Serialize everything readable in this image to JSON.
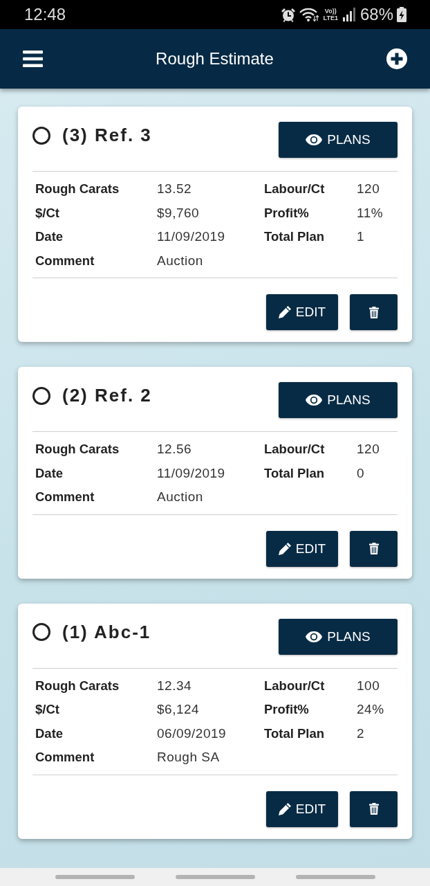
{
  "status_bar": {
    "time": "12:48",
    "network_lines": [
      "Vo))",
      "LTE1"
    ],
    "battery": "68%"
  },
  "app_bar": {
    "title": "Rough Estimate"
  },
  "cards": [
    {
      "title": "(3) Ref. 3",
      "selected": false,
      "plans_button": "PLANS",
      "rows": [
        {
          "label": "Rough Carats",
          "value": "13.52",
          "label_2": "Labour/Ct",
          "value_2": "120"
        },
        {
          "label": "$/Ct",
          "value": "$9,760",
          "label_2": "Profit%",
          "value_2": "11%"
        },
        {
          "label": "Date",
          "value": "11/09/2019",
          "label_2": "Total Plan",
          "value_2": "1"
        },
        {
          "label": "Comment",
          "value": "Auction"
        }
      ],
      "edit_button": "EDIT"
    },
    {
      "title": "(2) Ref. 2",
      "selected": false,
      "plans_button": "PLANS",
      "rows": [
        {
          "label": "Rough Carats",
          "value": "12.56",
          "label_2": "Labour/Ct",
          "value_2": "120"
        },
        {
          "label": "Date",
          "value": "11/09/2019",
          "label_2": "Total Plan",
          "value_2": "0"
        },
        {
          "label": "Comment",
          "value": "Auction"
        }
      ],
      "edit_button": "EDIT"
    },
    {
      "title": "(1) Abc-1",
      "selected": false,
      "plans_button": "PLANS",
      "rows": [
        {
          "label": "Rough Carats",
          "value": "12.34",
          "label_2": "Labour/Ct",
          "value_2": "100"
        },
        {
          "label": "$/Ct",
          "value": "$6,124",
          "label_2": "Profit%",
          "value_2": "24%"
        },
        {
          "label": "Date",
          "value": "06/09/2019",
          "label_2": "Total Plan",
          "value_2": "2"
        },
        {
          "label": "Comment",
          "value": "Rough SA"
        }
      ],
      "edit_button": "EDIT"
    }
  ]
}
